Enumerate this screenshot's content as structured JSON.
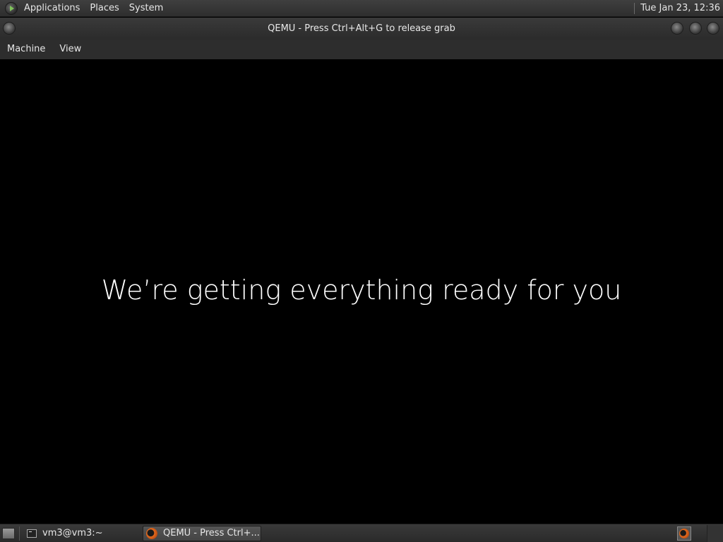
{
  "top_panel": {
    "menus": [
      "Applications",
      "Places",
      "System"
    ],
    "clock": "Tue Jan 23, 12:36"
  },
  "window": {
    "title": "QEMU - Press Ctrl+Alt+G to release grab",
    "menubar": [
      "Machine",
      "View"
    ]
  },
  "vm_screen": {
    "message": "We’re getting everything ready for you"
  },
  "taskbar": {
    "tasks": [
      {
        "label": "vm3@vm3:~",
        "icon": "terminal-icon"
      },
      {
        "label": "QEMU - Press Ctrl+...",
        "icon": "qemu-icon"
      }
    ]
  },
  "colors": {
    "panel_bg": "#2e2e2e",
    "vm_bg": "#000000",
    "text": "#e6e6e6",
    "qemu_orange": "#e36b1f"
  }
}
